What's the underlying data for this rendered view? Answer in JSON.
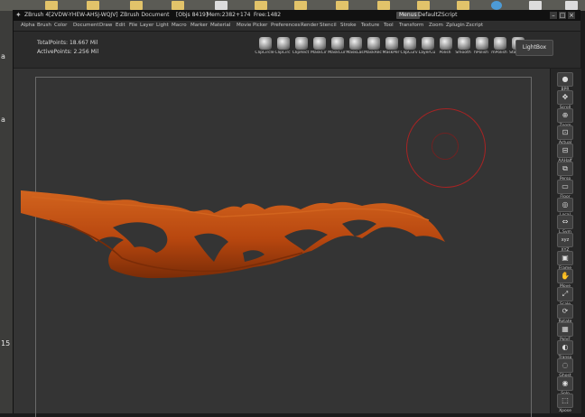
{
  "window": {
    "title": "ZBrush 4[2VDW-YHEW-AHSJ-WQJV]",
    "document": "ZBrush Document",
    "objs": "[Objs 8419]",
    "mem": "Mem:2382+174",
    "free": "Free:1482",
    "menus_label": "Menus",
    "script_label": "DefaultZScript"
  },
  "menubar": {
    "items": [
      "Alpha",
      "Brush",
      "Color",
      "Document",
      "Draw",
      "Edit",
      "File",
      "Layer",
      "Light",
      "Macro",
      "Marker",
      "Material",
      "Movie",
      "Picker",
      "Preferences",
      "Render",
      "Stencil",
      "Stroke",
      "Texture",
      "Tool",
      "Transform",
      "Zoom",
      "Zplugin",
      "Zscript"
    ]
  },
  "toolbar": {
    "total_points": "TotalPoints: 18.667 Mil",
    "active_points": "ActivePoints: 2.256 Mil",
    "brushes": [
      "ClipCircle",
      "ClipCirc",
      "ClipRect",
      "MaskCir",
      "MaskCur",
      "MaskLas",
      "MaskRec",
      "MaskPer",
      "ClipCurv",
      "LayerCu",
      "Polish",
      "Smooth",
      "hPolish",
      "mPolish",
      "Standar"
    ],
    "lightbox_label": "LightBox"
  },
  "right_tray": {
    "buttons": [
      {
        "label": "BPR",
        "icon": "sphere-icon"
      },
      {
        "label": "Scroll",
        "icon": "scroll-icon"
      },
      {
        "label": "Zoom",
        "icon": "zoom-icon"
      },
      {
        "label": "Actual",
        "icon": "actual-icon"
      },
      {
        "label": "AAHalf",
        "icon": "aahalf-icon"
      },
      {
        "label": "Persp",
        "icon": "persp-icon"
      },
      {
        "label": "Floor",
        "icon": "floor-icon"
      },
      {
        "label": "Local",
        "icon": "local-icon"
      },
      {
        "label": "L.Sym",
        "icon": "lsym-icon"
      },
      {
        "label": "XYZ",
        "icon": "xyz-icon"
      },
      {
        "label": "Frame",
        "icon": "frame-icon"
      },
      {
        "label": "Move",
        "icon": "move-icon"
      },
      {
        "label": "Scale",
        "icon": "scale-icon"
      },
      {
        "label": "Rotate",
        "icon": "rotate-icon"
      },
      {
        "label": "PolyF",
        "icon": "polyf-icon"
      },
      {
        "label": "Transp",
        "icon": "transp-icon"
      },
      {
        "label": "Ghost",
        "icon": "ghost-icon"
      },
      {
        "label": "Solo",
        "icon": "solo-icon"
      },
      {
        "label": "Xpose",
        "icon": "xpose-icon"
      }
    ]
  },
  "colors": {
    "flame": "#b8470f",
    "flame_highlight": "#d2641e",
    "flame_shadow": "#7a2c07",
    "cursor_ring": "#a82323",
    "canvas_bg": "#343434"
  },
  "desktop_edge": {
    "top_label": "a",
    "mid_label": "a",
    "bottom_label": "15"
  }
}
